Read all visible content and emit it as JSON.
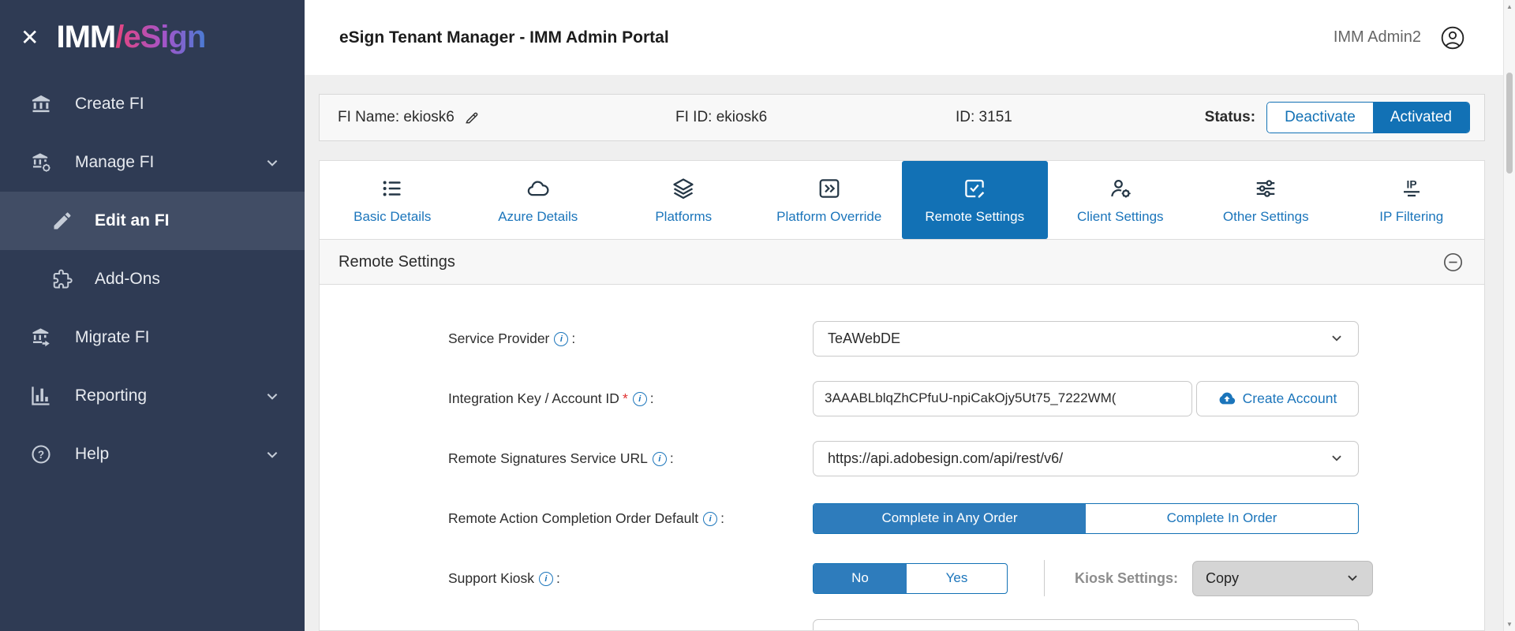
{
  "sidebar": {
    "close_icon": "✕",
    "logo": {
      "part1": "IMM",
      "part2": "/eSign"
    },
    "items": [
      {
        "label": "Create FI",
        "icon": "bank-icon"
      },
      {
        "label": "Manage FI",
        "icon": "manage-fi-icon",
        "expanded": true
      },
      {
        "label": "Edit an FI",
        "icon": "pencil-icon",
        "active": true
      },
      {
        "label": "Add-Ons",
        "icon": "puzzle-icon"
      },
      {
        "label": "Migrate FI",
        "icon": "migrate-fi-icon"
      },
      {
        "label": "Reporting",
        "icon": "bar-chart-icon",
        "collapsible": true
      },
      {
        "label": "Help",
        "icon": "help-icon",
        "collapsible": true
      }
    ]
  },
  "header": {
    "title": "eSign Tenant Manager - IMM Admin Portal",
    "user": "IMM Admin2"
  },
  "fi_bar": {
    "fi_name": "FI Name: ekiosk6",
    "fi_id": "FI ID: ekiosk6",
    "id": "ID: 3151",
    "status_label": "Status:",
    "buttons": [
      {
        "label": "Deactivate",
        "active": false
      },
      {
        "label": "Activated",
        "active": true
      }
    ]
  },
  "tabs": [
    {
      "label": "Basic Details",
      "icon": "list-icon"
    },
    {
      "label": "Azure Details",
      "icon": "cloud-icon"
    },
    {
      "label": "Platforms",
      "icon": "layers-icon"
    },
    {
      "label": "Platform Override",
      "icon": "override-icon"
    },
    {
      "label": "Remote Settings",
      "icon": "remote-settings-icon",
      "active": true
    },
    {
      "label": "Client Settings",
      "icon": "client-settings-icon"
    },
    {
      "label": "Other Settings",
      "icon": "sliders-icon"
    },
    {
      "label": "IP Filtering",
      "icon": "ip-filter-icon"
    }
  ],
  "section": {
    "title": "Remote Settings"
  },
  "form": {
    "label_suffix": ":",
    "required_mark": "*",
    "info_glyph": "i",
    "rows": [
      {
        "label": "Service Provider",
        "type": "select",
        "value": "TeAWebDE"
      },
      {
        "label": "Integration Key / Account ID",
        "type": "input",
        "value": "3AAABLblqZhCPfuU-npiCakOjy5Ut75_7222WM(",
        "button_label": "Create Account"
      },
      {
        "label": "Remote Signatures Service URL",
        "type": "select",
        "value": "https://api.adobesign.com/api/rest/v6/"
      },
      {
        "label": "Remote Action Completion Order Default",
        "type": "toggle",
        "options": [
          "Complete in Any Order",
          "Complete In Order"
        ],
        "selected": "Complete in Any Order"
      },
      {
        "label": "Support Kiosk",
        "type": "toggle",
        "options": [
          "No",
          "Yes"
        ],
        "selected": "No",
        "extra_label": "Kiosk Settings:",
        "extra_value": "Copy"
      }
    ]
  },
  "colors": {
    "accent_blue": "#1271b5",
    "link_blue": "#1b75bb",
    "sidebar_bg": "#2f3b54",
    "sidebar_active_bg": "#414d65"
  }
}
